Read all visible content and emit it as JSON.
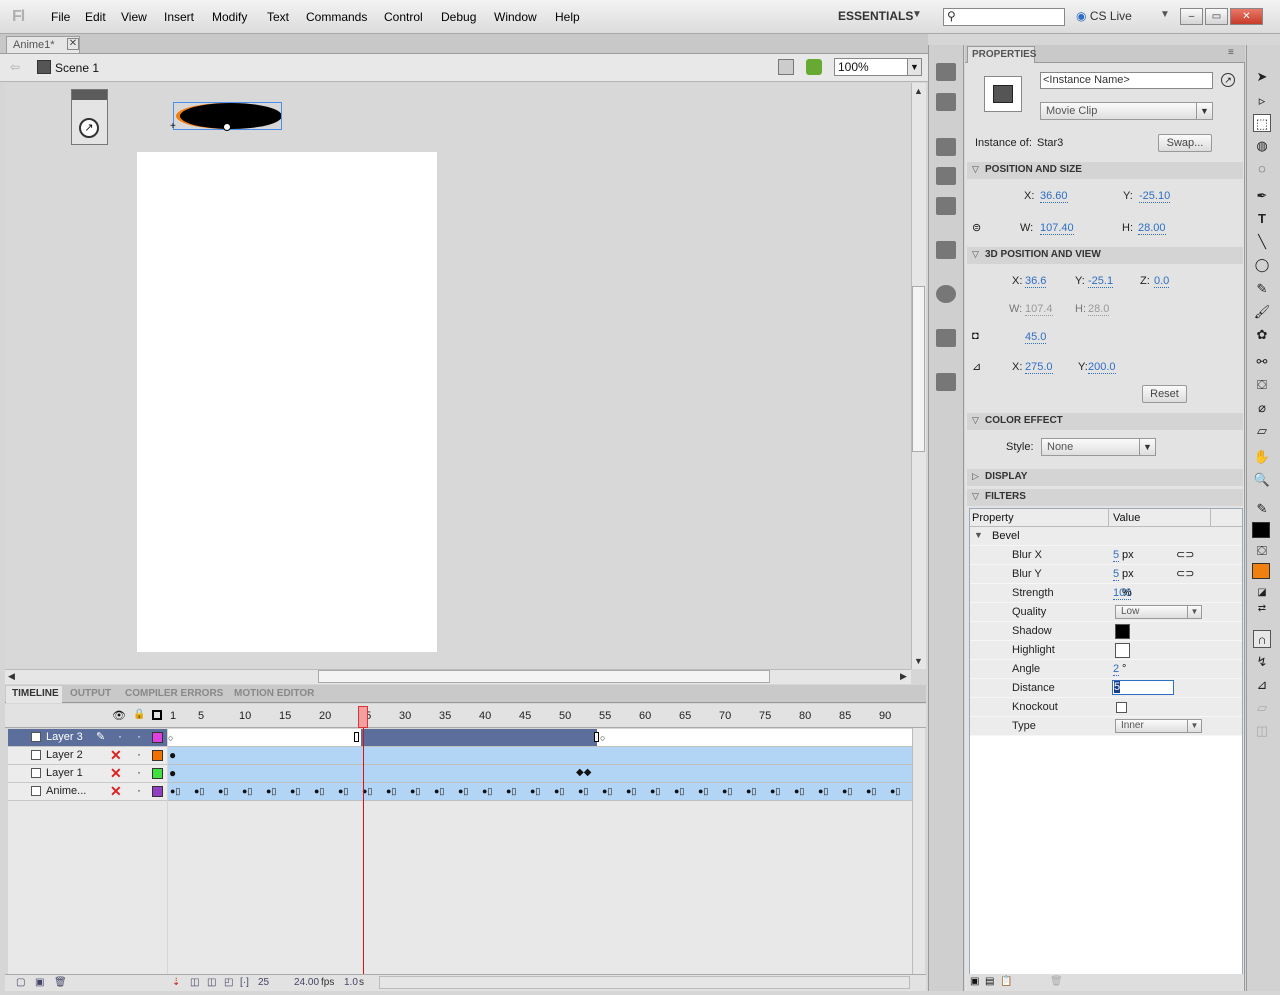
{
  "app": {
    "logo": "Fl"
  },
  "menu": [
    "File",
    "Edit",
    "View",
    "Insert",
    "Modify",
    "Text",
    "Commands",
    "Control",
    "Debug",
    "Window",
    "Help"
  ],
  "workspace": {
    "label": "ESSENTIALS",
    "arrow": "▼"
  },
  "search": {
    "icon": "search-icon",
    "value": ""
  },
  "cslive": {
    "label": "CS Live",
    "arrow": "▼"
  },
  "window_buttons": {
    "min": "–",
    "max": "▭",
    "close": "✕"
  },
  "document": {
    "tab": "Anime1*",
    "close": "✕"
  },
  "editbar": {
    "scene": "Scene 1",
    "zoom": "100%"
  },
  "timeline": {
    "tabs": [
      "TIMELINE",
      "OUTPUT",
      "COMPILER ERRORS",
      "MOTION EDITOR"
    ],
    "ruler": [
      "1",
      "5",
      "10",
      "15",
      "20",
      "25",
      "30",
      "35",
      "40",
      "45",
      "50",
      "55",
      "60",
      "65",
      "70",
      "75",
      "80",
      "85",
      "90"
    ],
    "playhead_frame": 25,
    "layers": [
      {
        "name": "Layer 3",
        "color": "#e040e0",
        "selected": true
      },
      {
        "name": "Layer 2",
        "color": "#f07000",
        "selected": false
      },
      {
        "name": "Layer 1",
        "color": "#40e040",
        "selected": false
      },
      {
        "name": "Anime...",
        "color": "#9040c0",
        "selected": false
      }
    ],
    "footer": {
      "frame": "25",
      "fps": "24.00",
      "fps_unit": "fps",
      "time": "1.0",
      "time_unit": "s"
    }
  },
  "properties": {
    "tab": "PROPERTIES",
    "instance_name_placeholder": "<Instance Name>",
    "instance_type": "Movie Clip",
    "instance_of_label": "Instance of:",
    "instance_of": "Star3",
    "swap_label": "Swap...",
    "pos_size": {
      "title": "POSITION AND SIZE",
      "x_label": "X:",
      "x": "36.60",
      "y_label": "Y:",
      "y": "-25.10",
      "w_label": "W:",
      "w": "107.40",
      "h_label": "H:",
      "h": "28.00"
    },
    "pos3d": {
      "title": "3D POSITION AND VIEW",
      "x_label": "X:",
      "x": "36.6",
      "y_label": "Y:",
      "y": "-25.1",
      "z_label": "Z:",
      "z": "0.0",
      "w_label": "W:",
      "w": "107.4",
      "h_label": "H:",
      "h": "28.0",
      "perspective": "45.0",
      "vx_label": "X:",
      "vx": "275.0",
      "vy_label": "Y:",
      "vy": "200.0",
      "reset": "Reset"
    },
    "color_effect": {
      "title": "COLOR EFFECT",
      "style_label": "Style:",
      "style": "None"
    },
    "display": {
      "title": "DISPLAY"
    },
    "filters": {
      "title": "FILTERS",
      "col_property": "Property",
      "col_value": "Value",
      "filter_name": "Bevel",
      "rows": [
        {
          "name": "Blur X",
          "value": "5",
          "unit": "px"
        },
        {
          "name": "Blur Y",
          "value": "5",
          "unit": "px"
        },
        {
          "name": "Strength",
          "value": "100",
          "unit": "%"
        },
        {
          "name": "Quality",
          "value": "Low",
          "unit": ""
        },
        {
          "name": "Shadow",
          "value": "",
          "unit": ""
        },
        {
          "name": "Highlight",
          "value": "",
          "unit": ""
        },
        {
          "name": "Angle",
          "value": "2",
          "unit": "°"
        },
        {
          "name": "Distance",
          "value": "5",
          "unit": ""
        },
        {
          "name": "Knockout",
          "value": "",
          "unit": ""
        },
        {
          "name": "Type",
          "value": "Inner",
          "unit": ""
        }
      ]
    }
  },
  "colors": {
    "accent": "#2f6ec5",
    "selected_layer": "#5c6f9c",
    "playhead": "#dd1111",
    "stroke_swatch": "#000000",
    "fill_swatch": "#f08010"
  }
}
